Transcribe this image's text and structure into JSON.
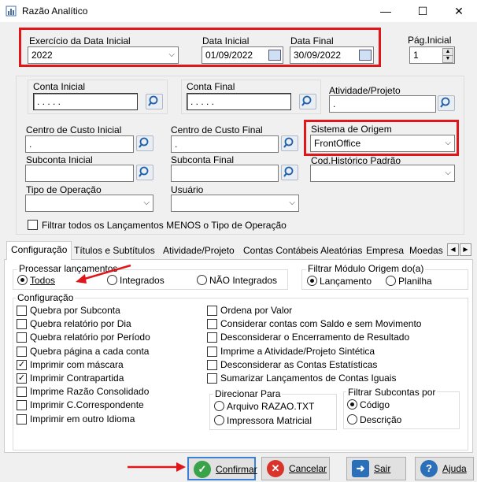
{
  "window": {
    "title": "Razão Analítico",
    "minimize": "—",
    "maximize": "☐",
    "close": "✕"
  },
  "top": {
    "exercicio_label": "Exercício da Data Inicial",
    "exercicio_value": "2022",
    "data_inicial_label": "Data Inicial",
    "data_inicial_value": "01/09/2022",
    "data_final_label": "Data Final",
    "data_final_value": "30/09/2022",
    "pag_inicial_label": "Pág.Inicial",
    "pag_inicial_value": "1"
  },
  "filters": {
    "conta_inicial_label": "Conta Inicial",
    "conta_inicial_value": ". . . . .",
    "conta_final_label": "Conta Final",
    "conta_final_value": ". . . . .",
    "atividade_label": "Atividade/Projeto",
    "atividade_value": ".",
    "cc_inicial_label": "Centro de Custo Inicial",
    "cc_inicial_value": ".",
    "cc_final_label": "Centro de Custo Final",
    "cc_final_value": ".",
    "sistema_label": "Sistema de Origem",
    "sistema_value": "FrontOffice",
    "subconta_inicial_label": "Subconta Inicial",
    "subconta_final_label": "Subconta Final",
    "historico_label": "Cod.Histórico Padrão",
    "tipo_op_label": "Tipo de Operação",
    "usuario_label": "Usuário",
    "filtrar_label": "Filtrar todos os Lançamentos MENOS o Tipo de Operação"
  },
  "tabs": [
    "Configuração",
    "Títulos e Subtítulos",
    "Atividade/Projeto",
    "Contas Contábeis Aleatórias",
    "Empresa",
    "Moedas"
  ],
  "processar": {
    "label": "Processar lançamentos",
    "options": [
      "Todos",
      "Integrados",
      "NÃO Integrados"
    ]
  },
  "filtrar_modulo": {
    "label": "Filtrar Módulo Origem do(a)",
    "options": [
      "Lançamento",
      "Planilha"
    ]
  },
  "configuracao": {
    "label": "Configuração",
    "left": [
      {
        "label": "Quebra por Subconta",
        "checked": false
      },
      {
        "label": "Quebra relatório por Dia",
        "checked": false
      },
      {
        "label": "Quebra relatório por Período",
        "checked": false
      },
      {
        "label": "Quebra página a cada conta",
        "checked": false
      },
      {
        "label": "Imprimir com máscara",
        "checked": true
      },
      {
        "label": "Imprimir Contrapartida",
        "checked": true
      },
      {
        "label": "Imprime Razão Consolidado",
        "checked": false
      },
      {
        "label": "Imprimir C.Correspondente",
        "checked": false
      },
      {
        "label": "Imprimir em outro Idioma",
        "checked": false
      }
    ],
    "right": [
      {
        "label": "Ordena por Valor",
        "checked": false
      },
      {
        "label": "Considerar contas com Saldo e sem Movimento",
        "checked": false
      },
      {
        "label": "Desconsiderar o Encerramento de Resultado",
        "checked": false
      },
      {
        "label": "Imprime a Atividade/Projeto Sintética",
        "checked": false
      },
      {
        "label": "Desconsiderar as Contas Estatísticas",
        "checked": false
      },
      {
        "label": "Sumarizar Lançamentos de Contas Iguais",
        "checked": false
      }
    ]
  },
  "direcionar": {
    "label": "Direcionar  Para",
    "options": [
      "Arquivo RAZAO.TXT",
      "Impressora Matricial"
    ]
  },
  "filtrar_sub": {
    "label": "Filtrar Subcontas por",
    "options": [
      "Código",
      "Descrição"
    ]
  },
  "buttons": {
    "confirmar": "Confirmar",
    "cancelar": "Cancelar",
    "sair": "Sair",
    "ajuda": "Ajuda"
  },
  "colors": {
    "highlight": "#e0161b",
    "confirm": "#3aa34a",
    "cancel": "#d9342b",
    "sair": "#2b6fb8",
    "ajuda": "#2b6fb8"
  }
}
